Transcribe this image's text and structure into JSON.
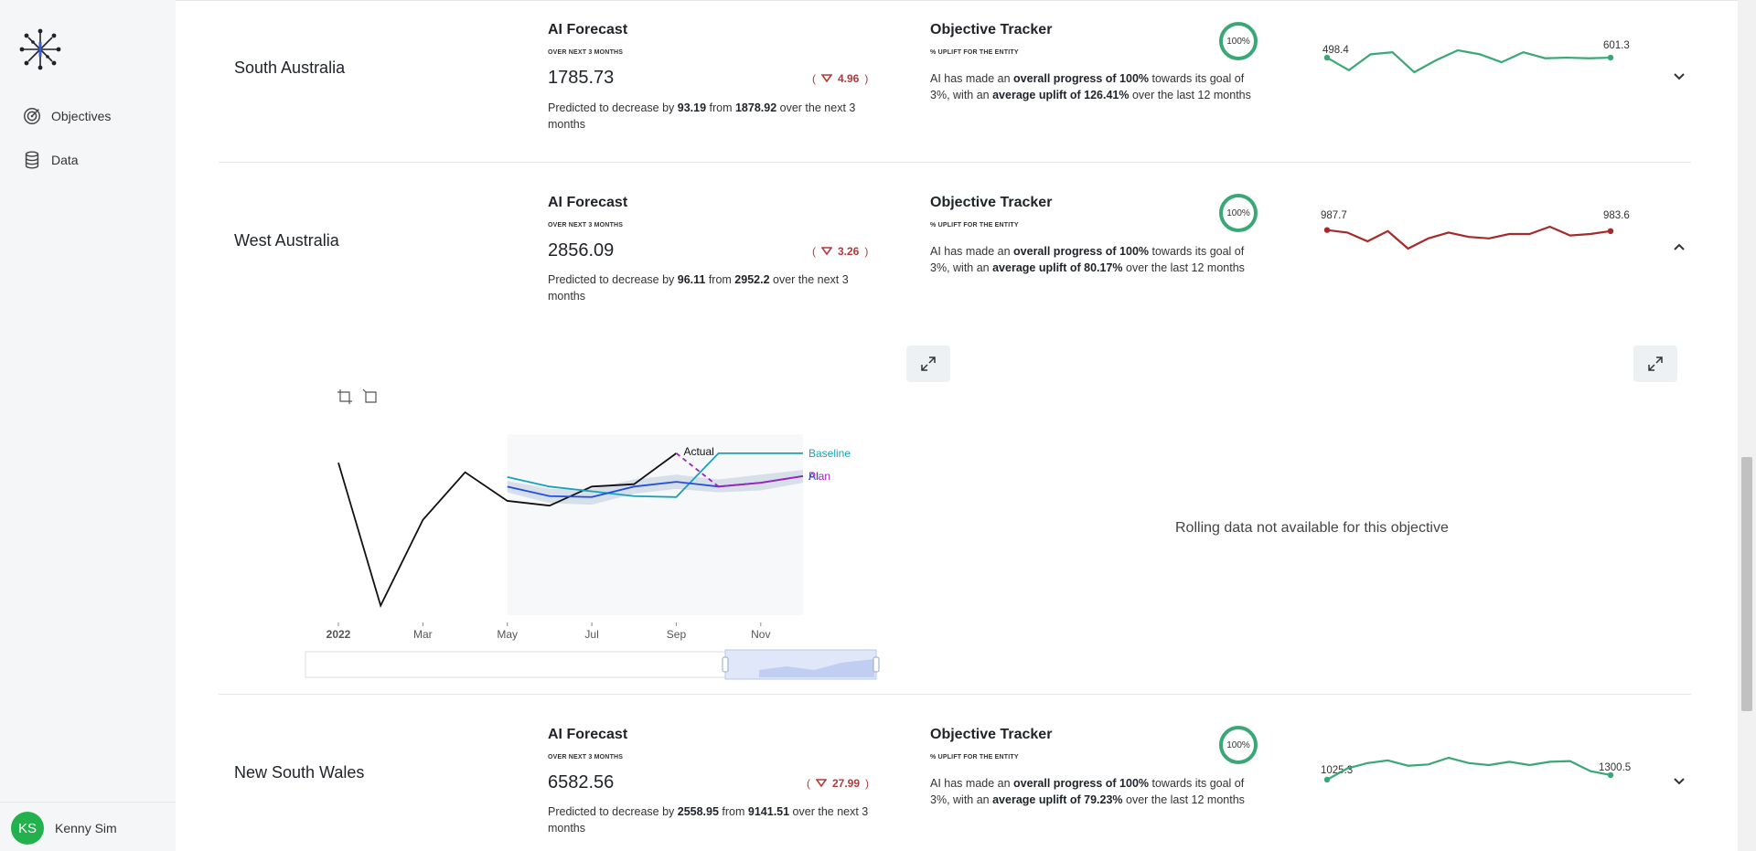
{
  "sidebar": {
    "nav": [
      {
        "label": "Objectives",
        "icon": "target-icon"
      },
      {
        "label": "Data",
        "icon": "database-icon"
      }
    ],
    "user": {
      "initials": "KS",
      "name": "Kenny Sim",
      "avatar_color": "#22b14c"
    }
  },
  "rows": [
    {
      "entity": "South Australia",
      "forecast": {
        "title": "AI Forecast",
        "subtitle": "OVER NEXT 3 MONTHS",
        "value": "1785.73",
        "delta": "4.96",
        "desc_pre": "Predicted to decrease by ",
        "desc_b1": "93.19",
        "desc_mid": " from ",
        "desc_b2": "1878.92",
        "desc_post": " over the next 3 months"
      },
      "tracker": {
        "title": "Objective Tracker",
        "subtitle": "% UPLIFT FOR THE ENTITY",
        "gauge": "100%",
        "l1_pre": "AI has made an ",
        "l1_b": "overall progress of 100%",
        "l1_post": " towards its goal of",
        "l2_pre": "3%, with an ",
        "l2_b": "average uplift of 126.41%",
        "l2_post": " over the last 12 months"
      },
      "spark": {
        "start": "498.4",
        "end": "601.3",
        "color": "#3aa876",
        "values": [
          601.3,
          595,
          603,
          604,
          594,
          600,
          605,
          603,
          599,
          604,
          601,
          601.3,
          601,
          601.3
        ]
      }
    },
    {
      "entity": "West Australia",
      "forecast": {
        "title": "AI Forecast",
        "subtitle": "OVER NEXT 3 MONTHS",
        "value": "2856.09",
        "delta": "3.26",
        "desc_pre": "Predicted to decrease by ",
        "desc_b1": "96.11",
        "desc_mid": " from ",
        "desc_b2": "2952.2",
        "desc_post": " over the next 3 months"
      },
      "tracker": {
        "title": "Objective Tracker",
        "subtitle": "% UPLIFT FOR THE ENTITY",
        "gauge": "100%",
        "l1_pre": "AI has made an ",
        "l1_b": "overall progress of 100%",
        "l1_post": " towards its goal of",
        "l2_pre": "3%, with an ",
        "l2_b": "average uplift of 80.17%",
        "l2_post": " over the last 12 months"
      },
      "spark": {
        "start": "987.7",
        "end": "983.6",
        "color": "#a52a2a",
        "values": [
          987.7,
          986,
          980,
          987,
          975,
          982,
          986,
          983,
          982,
          985,
          985,
          990,
          984,
          985,
          987
        ]
      }
    },
    {
      "entity": "New South Wales",
      "forecast": {
        "title": "AI Forecast",
        "subtitle": "OVER NEXT 3 MONTHS",
        "value": "6582.56",
        "delta": "27.99",
        "desc_pre": "Predicted to decrease by ",
        "desc_b1": "2558.95",
        "desc_mid": " from ",
        "desc_b2": "9141.51",
        "desc_post": " over the next 3 months"
      },
      "tracker": {
        "title": "Objective Tracker",
        "subtitle": "% UPLIFT FOR THE ENTITY",
        "gauge": "100%",
        "l1_pre": "AI has made an ",
        "l1_b": "overall progress of 100%",
        "l1_post": " towards its goal of",
        "l2_pre": "3%, with an ",
        "l2_b": "average uplift of 79.23%",
        "l2_post": " over the last 12 months"
      },
      "spark": {
        "start": "1025.3",
        "end": "1300.5",
        "color": "#3aa876",
        "values": [
          1025.3,
          1110,
          1150,
          1170,
          1130,
          1140,
          1190,
          1150,
          1135,
          1160,
          1135,
          1160,
          1165,
          1090,
          1060
        ]
      }
    }
  ],
  "expanded": {
    "rolling_message": "Rolling data not available for this objective",
    "chart_data": {
      "type": "line",
      "x_ticks": [
        "2022",
        "Mar",
        "May",
        "Jul",
        "Sep",
        "Nov"
      ],
      "series": [
        {
          "name": "Actual",
          "color": "#111111",
          "x": [
            0,
            1,
            2,
            3,
            4,
            5,
            6,
            7,
            8
          ],
          "values": [
            3000,
            2700,
            2880,
            2980,
            2920,
            2910,
            2950,
            2955,
            3020
          ]
        },
        {
          "name": "Baseline",
          "color": "#17a2b8",
          "x": [
            4,
            5,
            6,
            7,
            8,
            9,
            10,
            11
          ],
          "values": [
            2970,
            2950,
            2940,
            2930,
            2928,
            3020,
            3020,
            3020
          ]
        },
        {
          "name": "AI",
          "color": "#1f4fe0",
          "x": [
            4,
            5,
            6,
            7,
            8,
            9,
            10,
            11
          ],
          "values": [
            2950,
            2930,
            2928,
            2950,
            2960,
            2950,
            2958,
            2972
          ]
        },
        {
          "name": "Plan",
          "color": "#a020c0",
          "x": [
            8,
            9,
            10,
            11
          ],
          "values": [
            3020,
            2950,
            2958,
            2972
          ],
          "dashed_to": 9
        }
      ],
      "band": {
        "x": [
          4,
          5,
          6,
          7,
          8,
          9,
          10,
          11
        ],
        "upper": [
          2962,
          2945,
          2945,
          2965,
          2975,
          2965,
          2975,
          2985
        ],
        "lower": [
          2938,
          2915,
          2912,
          2935,
          2945,
          2938,
          2942,
          2958
        ]
      },
      "ylim": [
        2680,
        3060
      ],
      "xlim": [
        0,
        11
      ]
    }
  }
}
